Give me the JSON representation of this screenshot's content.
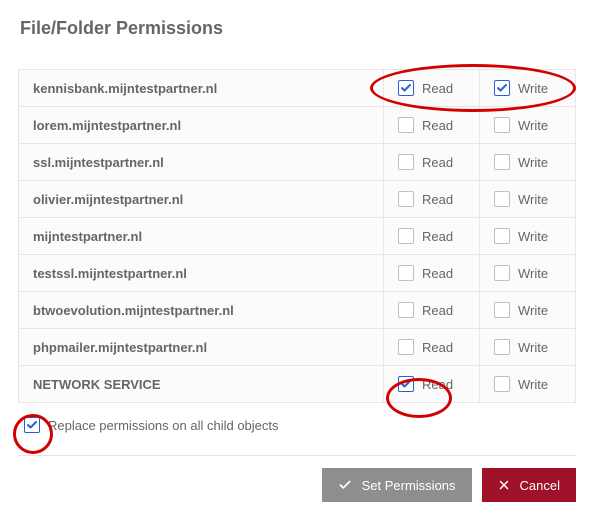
{
  "title": "File/Folder Permissions",
  "labels": {
    "read": "Read",
    "write": "Write"
  },
  "rows": [
    {
      "name": "kennisbank.mijntestpartner.nl",
      "read": true,
      "write": true
    },
    {
      "name": "lorem.mijntestpartner.nl",
      "read": false,
      "write": false
    },
    {
      "name": "ssl.mijntestpartner.nl",
      "read": false,
      "write": false
    },
    {
      "name": "olivier.mijntestpartner.nl",
      "read": false,
      "write": false
    },
    {
      "name": "mijntestpartner.nl",
      "read": false,
      "write": false
    },
    {
      "name": "testssl.mijntestpartner.nl",
      "read": false,
      "write": false
    },
    {
      "name": "btwoevolution.mijntestpartner.nl",
      "read": false,
      "write": false
    },
    {
      "name": "phpmailer.mijntestpartner.nl",
      "read": false,
      "write": false
    },
    {
      "name": "NETWORK SERVICE",
      "read": true,
      "write": false
    }
  ],
  "replace": {
    "checked": true,
    "label": "Replace permissions on all child objects"
  },
  "buttons": {
    "set": "Set Permissions",
    "cancel": "Cancel"
  }
}
